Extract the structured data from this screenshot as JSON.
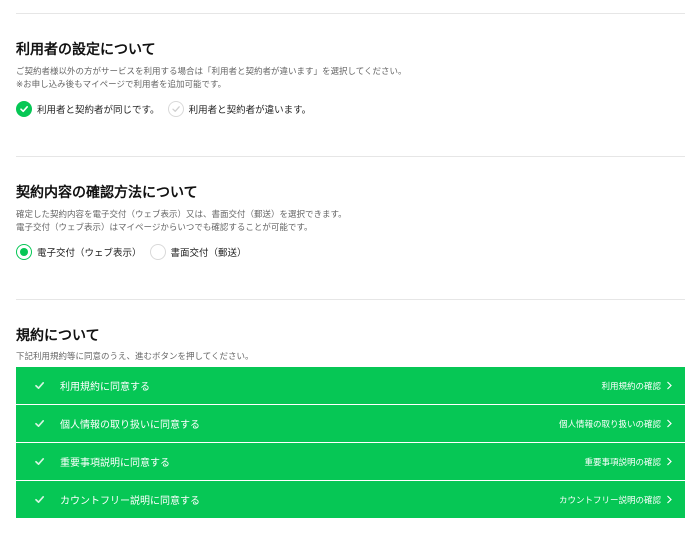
{
  "user_section": {
    "title": "利用者の設定について",
    "desc1": "ご契約者様以外の方がサービスを利用する場合は「利用者と契約者が違います」を選択してください。",
    "desc2": "※お申し込み後もマイページで利用者を追加可能です。",
    "option_same": "利用者と契約者が同じです。",
    "option_different": "利用者と契約者が違います。"
  },
  "confirm_section": {
    "title": "契約内容の確認方法について",
    "desc1": "確定した契約内容を電子交付（ウェブ表示）又は、書面交付（郵送）を選択できます。",
    "desc2": "電子交付（ウェブ表示）はマイページからいつでも確認することが可能です。",
    "option_electronic": "電子交付（ウェブ表示）",
    "option_paper": "書面交付（郵送）"
  },
  "terms_section": {
    "title": "規約について",
    "desc": "下記利用規約等に同意のうえ、進むボタンを押してください。",
    "items": [
      {
        "label": "利用規約に同意する",
        "link": "利用規約の確認"
      },
      {
        "label": "個人情報の取り扱いに同意する",
        "link": "個人情報の取り扱いの確認"
      },
      {
        "label": "重要事項説明に同意する",
        "link": "重要事項説明の確認"
      },
      {
        "label": "カウントフリー説明に同意する",
        "link": "カウントフリー説明の確認"
      }
    ]
  },
  "colors": {
    "accent": "#06c755",
    "divider": "#e6e6e6",
    "muted_text": "#666666"
  }
}
